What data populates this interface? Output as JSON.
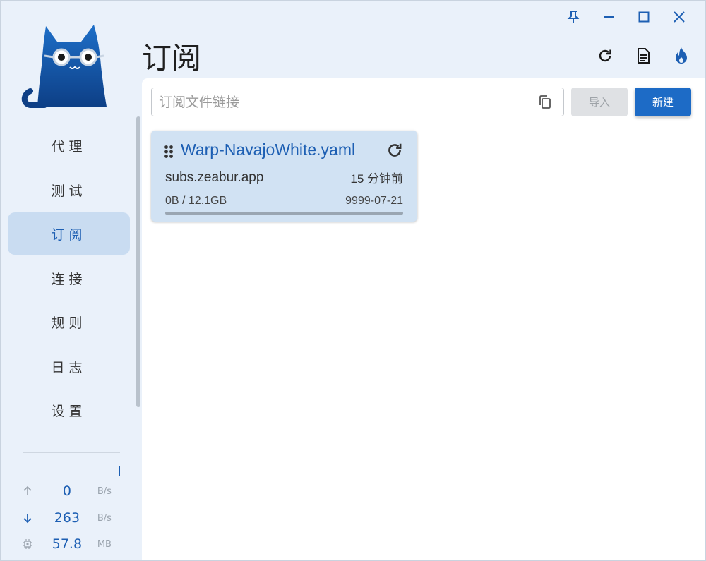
{
  "window": {
    "controls": [
      "pin-icon",
      "minimize-icon",
      "maximize-icon",
      "close-icon"
    ]
  },
  "page": {
    "title": "订阅"
  },
  "header_actions": [
    "refresh-icon",
    "document-icon",
    "flame-icon"
  ],
  "sidebar": {
    "items": [
      {
        "label": "代理",
        "active": false
      },
      {
        "label": "测试",
        "active": false
      },
      {
        "label": "订阅",
        "active": true
      },
      {
        "label": "连接",
        "active": false
      },
      {
        "label": "规则",
        "active": false
      },
      {
        "label": "日志",
        "active": false
      },
      {
        "label": "设置",
        "active": false
      }
    ]
  },
  "stats": {
    "upload": {
      "value": "0",
      "unit": "B/s"
    },
    "download": {
      "value": "263",
      "unit": "B/s"
    },
    "memory": {
      "value": "57.8",
      "unit": "MB"
    }
  },
  "toolbar": {
    "url_placeholder": "订阅文件链接",
    "url_value": "",
    "import_label": "导入",
    "new_label": "新建"
  },
  "profiles": [
    {
      "name": "Warp-NavajoWhite.yaml",
      "host": "subs.zeabur.app",
      "updated": "15 分钟前",
      "usage": "0B / 12.1GB",
      "expire": "9999-07-21",
      "progress": 0
    }
  ],
  "colors": {
    "accent": "#1d5fb3",
    "active_nav_bg": "#c9dcf1",
    "card_bg": "#d1e2f3",
    "app_bg": "#eaf1fa",
    "primary_button": "#1d6bc6"
  }
}
